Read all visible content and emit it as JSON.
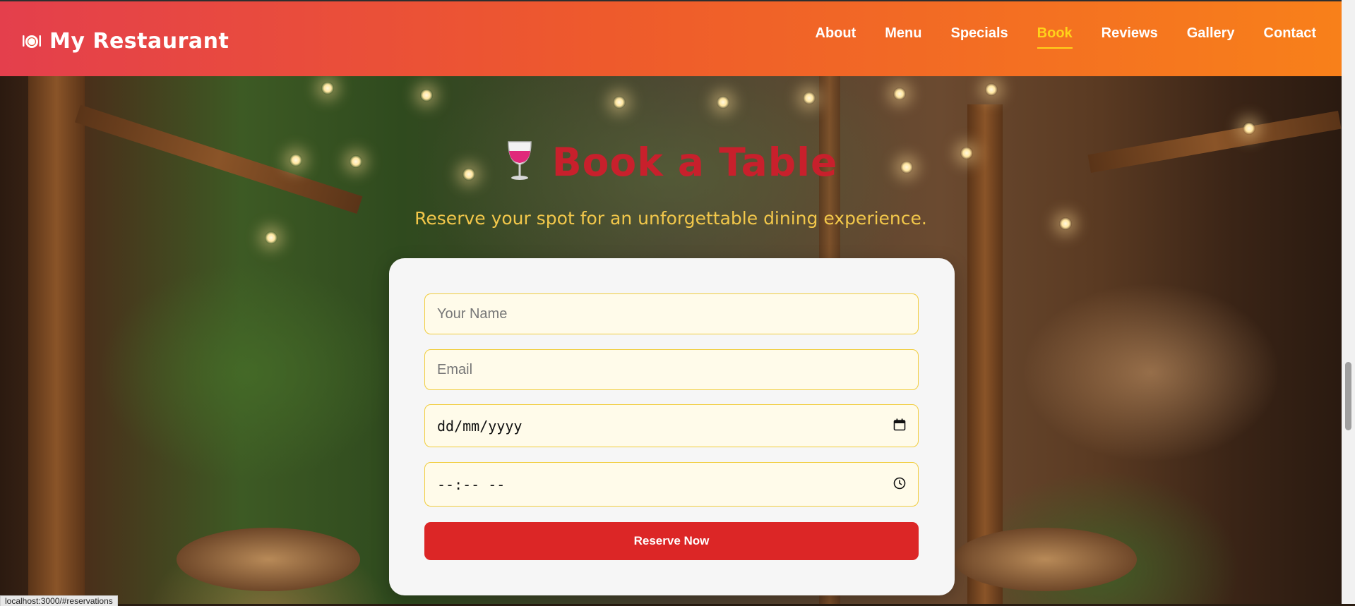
{
  "brand": {
    "icon": "plate-cutlery-icon",
    "name": "My Restaurant"
  },
  "nav": {
    "items": [
      {
        "label": "About"
      },
      {
        "label": "Menu"
      },
      {
        "label": "Specials"
      },
      {
        "label": "Book",
        "active": true
      },
      {
        "label": "Reviews"
      },
      {
        "label": "Gallery"
      },
      {
        "label": "Contact"
      }
    ],
    "active_color": "#ffd21a"
  },
  "hero": {
    "icon": "wine-glass-icon",
    "title": "Book a Table",
    "subtitle": "Reserve your spot for an unforgettable dining experience."
  },
  "form": {
    "name_placeholder": "Your Name",
    "email_placeholder": "Email",
    "date_placeholder": "dd/mm/yyyy",
    "time_placeholder": "--:-- --",
    "submit_label": "Reserve Now"
  },
  "status_bar": {
    "url": "localhost:3000/#reservations"
  },
  "colors": {
    "nav_gradient_start": "#e43f4c",
    "nav_gradient_end": "#f8801a",
    "title": "#c8202c",
    "subtitle": "#f2c74a",
    "button": "#dc2626",
    "field_border": "#f1cd3e",
    "field_bg": "#fffbea"
  }
}
